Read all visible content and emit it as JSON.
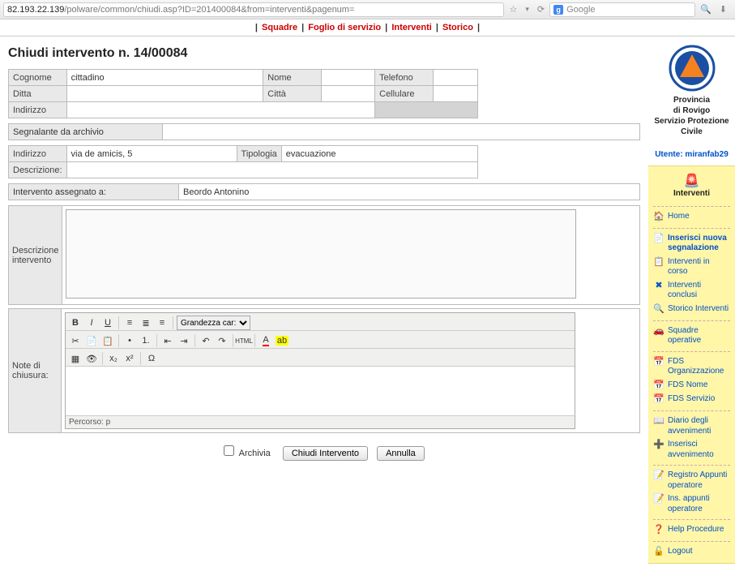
{
  "browser": {
    "host": "82.193.22.139",
    "path": "/polware/common/chiudi.asp?ID=201400084&from=interventi&pagenum=",
    "search_placeholder": "Google"
  },
  "nav": {
    "squadre": "Squadre",
    "foglio": "Foglio di servizio",
    "interventi": "Interventi",
    "storico": "Storico"
  },
  "title": "Chiudi intervento n. 14/00084",
  "form1": {
    "cognome_lbl": "Cognome",
    "cognome": "cittadino",
    "nome_lbl": "Nome",
    "nome": "",
    "telefono_lbl": "Telefono",
    "telefono": "",
    "ditta_lbl": "Ditta",
    "ditta": "",
    "citta_lbl": "Città",
    "citta": "",
    "cellulare_lbl": "Cellulare",
    "cellulare": "",
    "indirizzo_lbl": "Indirizzo",
    "indirizzo": ""
  },
  "segnalante_lbl": "Segnalante da archivio",
  "segnalante": "",
  "form2": {
    "indirizzo_lbl": "Indirizzo",
    "indirizzo": "via de amicis, 5",
    "tipologia_lbl": "Tipologia",
    "tipologia": "evacuazione",
    "descr_lbl": "Descrizione:",
    "descr": ""
  },
  "assegnato_lbl": "Intervento assegnato a:",
  "assegnato": "Beordo  Antonino",
  "desc_intervento_lbl": "Descrizione intervento",
  "desc_intervento": "",
  "note_lbl": "Note di chiusura:",
  "editor": {
    "fontsize_label": "Grandezza car:",
    "path": "Percorso: p"
  },
  "bottom": {
    "archivia": "Archivia",
    "chiudi": "Chiudi Intervento",
    "annulla": "Annulla"
  },
  "side": {
    "org1": "Provincia",
    "org2": "di Rovigo",
    "org3": "Servizio Protezione Civile",
    "utente_lbl": "Utente: miranfab29",
    "head": "Interventi",
    "home": "Home",
    "ins_nuova": "Inserisci nuova segnalazione",
    "incorso": "Interventi in corso",
    "conclusi": "Interventi conclusi",
    "storico_int": "Storico Interventi",
    "squadre_op": "Squadre operative",
    "fds_org": "FDS Organizzazione",
    "fds_nome": "FDS Nome",
    "fds_servizio": "FDS Servizio",
    "diario": "Diario degli avvenimenti",
    "ins_avv": "Inserisci avvenimento",
    "reg_app": "Registro Appunti operatore",
    "ins_app": "Ins. appunti operatore",
    "help": "Help Procedure",
    "logout": "Logout"
  }
}
